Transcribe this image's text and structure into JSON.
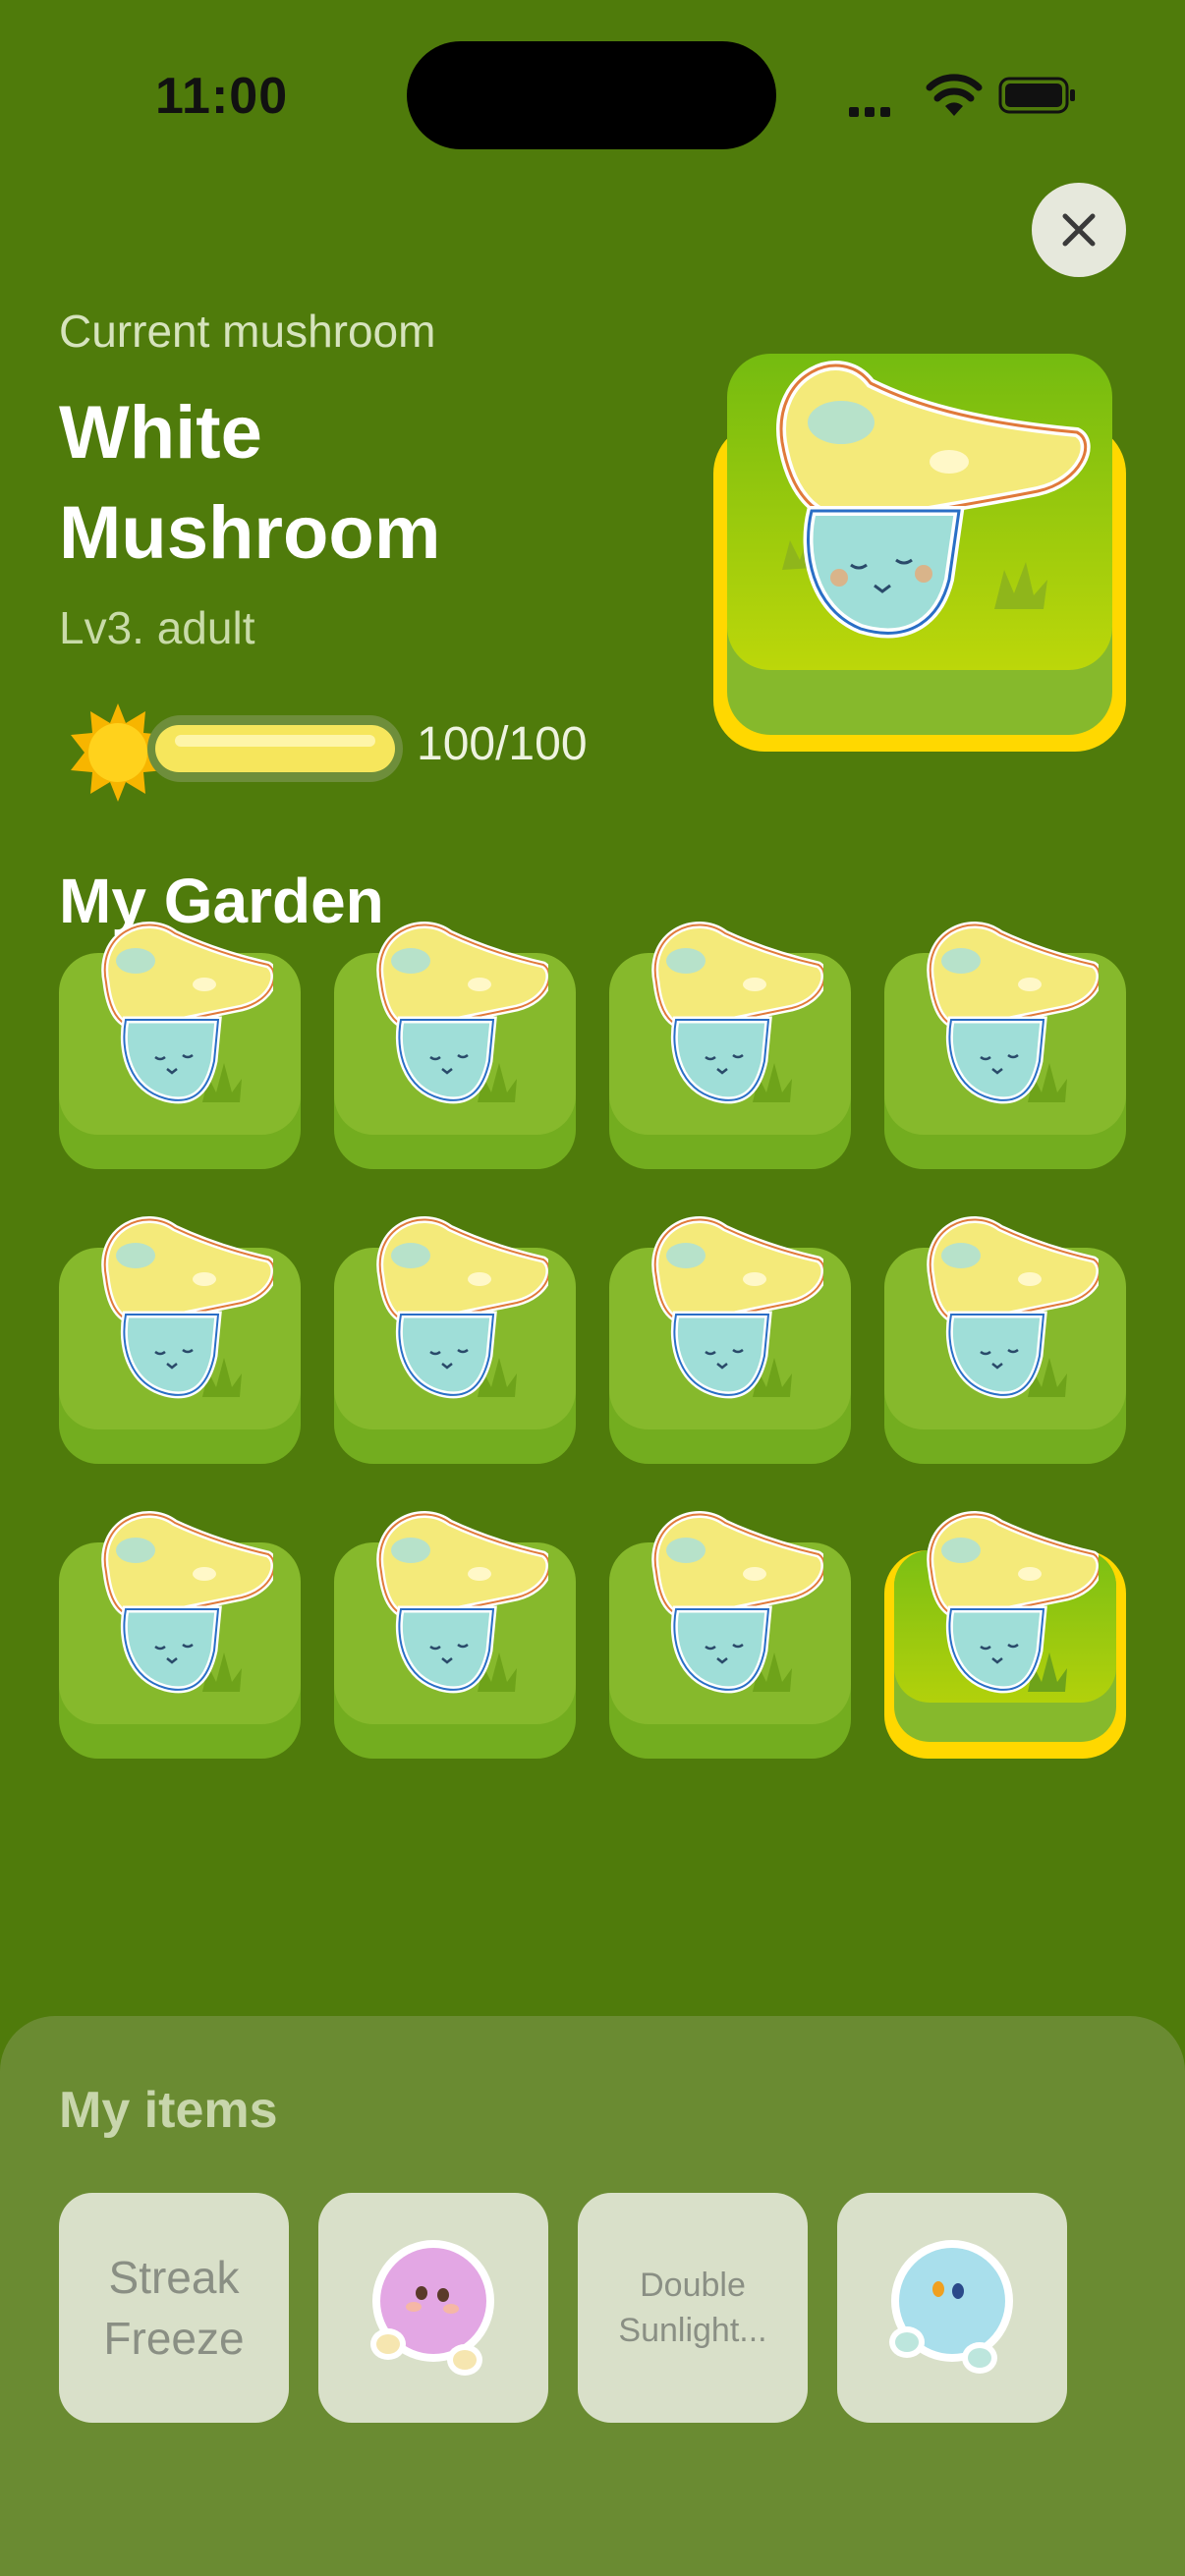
{
  "status_bar": {
    "time": "11:00"
  },
  "header": {
    "subtitle": "Current mushroom",
    "title": "White Mushroom",
    "level": "Lv3. adult",
    "progress_text": "100/100",
    "progress_fraction": 1.0
  },
  "garden": {
    "title": "My Garden",
    "tiles": [
      {
        "selected": false
      },
      {
        "selected": false
      },
      {
        "selected": false
      },
      {
        "selected": false
      },
      {
        "selected": false
      },
      {
        "selected": false
      },
      {
        "selected": false
      },
      {
        "selected": false
      },
      {
        "selected": false
      },
      {
        "selected": false
      },
      {
        "selected": false
      },
      {
        "selected": true
      }
    ]
  },
  "items": {
    "title": "My items",
    "list": [
      {
        "label": "Streak\nFreeze",
        "kind": "text"
      },
      {
        "label": "",
        "kind": "pink-creature-icon"
      },
      {
        "label": "Double\nSunlight...",
        "kind": "text-small"
      },
      {
        "label": "",
        "kind": "blue-creature-icon"
      }
    ]
  },
  "colors": {
    "background": "#4f7b0b",
    "accent_yellow": "#ffd800",
    "tile_green": "#86b92c"
  }
}
